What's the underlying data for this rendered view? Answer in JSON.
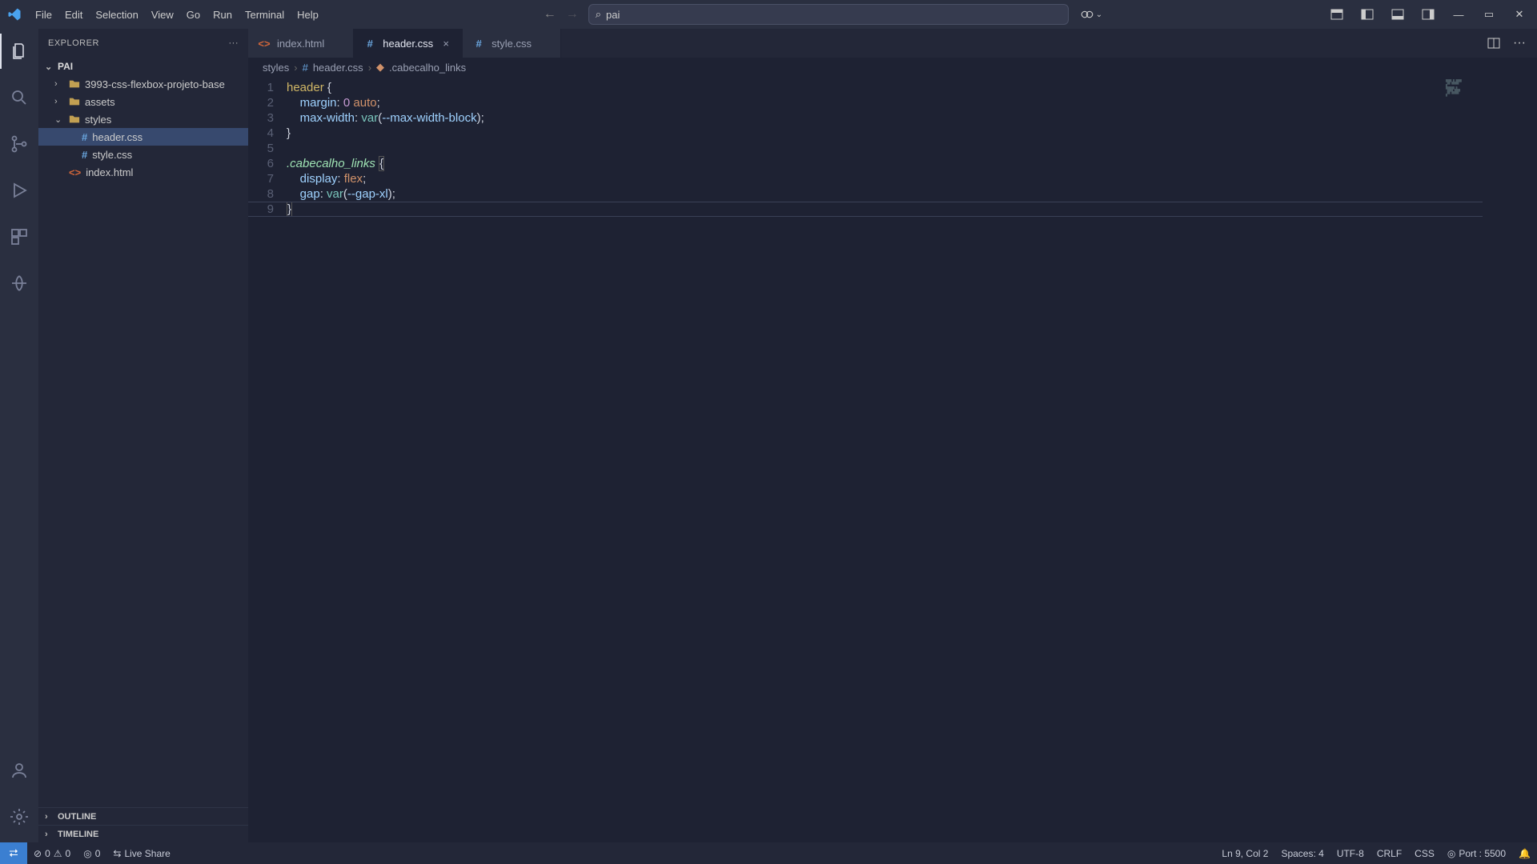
{
  "titlebar": {
    "menus": [
      "File",
      "Edit",
      "Selection",
      "View",
      "Go",
      "Run",
      "Terminal",
      "Help"
    ],
    "search": {
      "value": "pai"
    }
  },
  "sidebar": {
    "title": "EXPLORER",
    "root": "PAI",
    "tree": [
      {
        "twisty": "›",
        "name": "3993-css-flexbox-projeto-base",
        "type": "folder",
        "indent": 0
      },
      {
        "twisty": "›",
        "name": "assets",
        "type": "folder",
        "indent": 0
      },
      {
        "twisty": "⌄",
        "name": "styles",
        "type": "folder",
        "indent": 0
      },
      {
        "twisty": "",
        "name": "header.css",
        "type": "css",
        "indent": 1,
        "selected": true
      },
      {
        "twisty": "",
        "name": "style.css",
        "type": "css",
        "indent": 1
      },
      {
        "twisty": "",
        "name": "index.html",
        "type": "html",
        "indent": 0
      }
    ],
    "sections": [
      "OUTLINE",
      "TIMELINE"
    ]
  },
  "tabs": [
    {
      "name": "index.html",
      "type": "html",
      "active": false,
      "close": ""
    },
    {
      "name": "header.css",
      "type": "css",
      "active": true,
      "close": "×"
    },
    {
      "name": "style.css",
      "type": "css",
      "active": false,
      "close": ""
    }
  ],
  "breadcrumbs": [
    "styles",
    "header.css",
    ".cabecalho_links"
  ],
  "editor": {
    "lineCount": 9
  },
  "status": {
    "errors": "0",
    "warnings": "0",
    "ports": "0",
    "liveshare": "Live Share",
    "cursor": "Ln 9, Col 2",
    "spaces": "Spaces: 4",
    "encoding": "UTF-8",
    "eol": "CRLF",
    "lang": "CSS",
    "port": "Port : 5500"
  }
}
